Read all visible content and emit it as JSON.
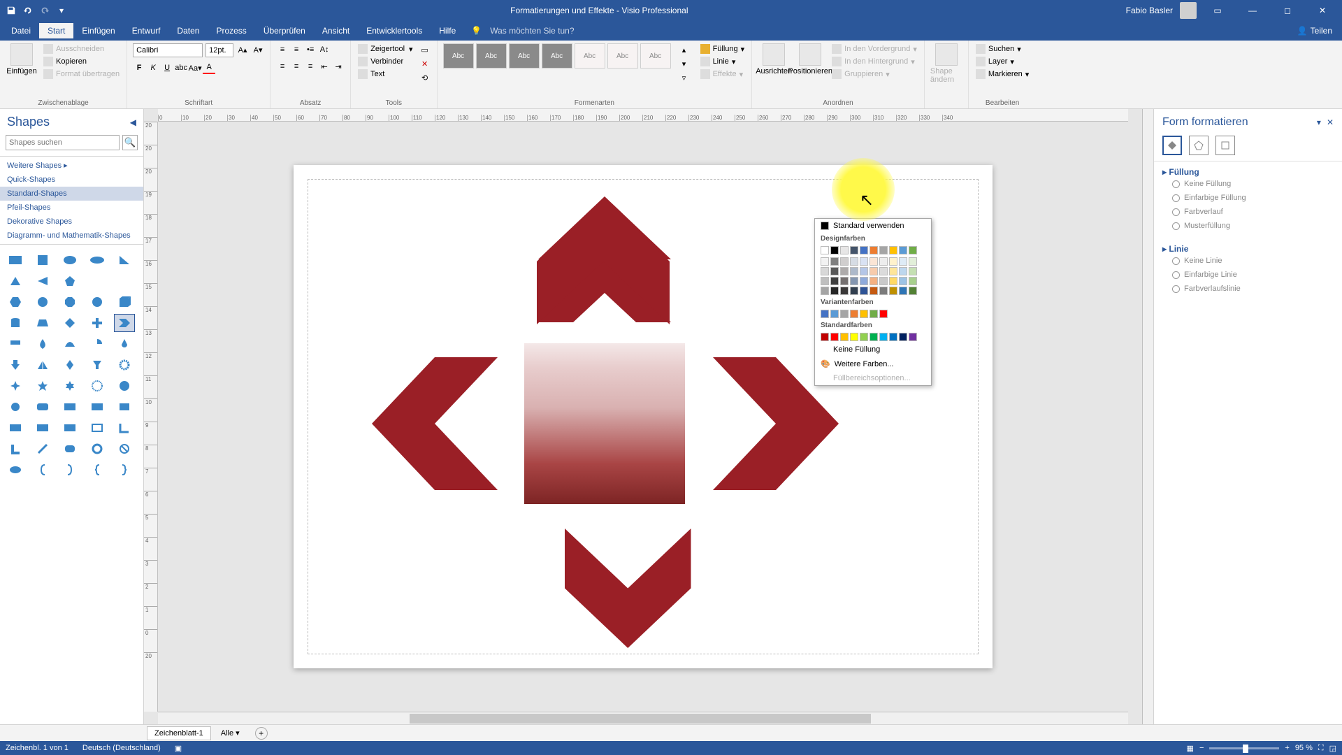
{
  "title": "Formatierungen und Effekte  -  Visio Professional",
  "user": "Fabio Basler",
  "share_label": "Teilen",
  "tabs": [
    "Datei",
    "Start",
    "Einfügen",
    "Entwurf",
    "Daten",
    "Prozess",
    "Überprüfen",
    "Ansicht",
    "Entwicklertools",
    "Hilfe"
  ],
  "active_tab": "Start",
  "tell_me": "Was möchten Sie tun?",
  "groups": {
    "clipboard": {
      "label": "Zwischenablage",
      "paste": "Einfügen",
      "cut": "Ausschneiden",
      "copy": "Kopieren",
      "painter": "Format übertragen"
    },
    "font": {
      "label": "Schriftart",
      "name": "Calibri",
      "size": "12pt."
    },
    "paragraph": {
      "label": "Absatz"
    },
    "tools": {
      "label": "Tools",
      "pointer": "Zeigertool",
      "connector": "Verbinder",
      "text": "Text"
    },
    "styles": {
      "label": "Formenarten",
      "fill": "Füllung",
      "line": "Linie",
      "effects": "Effekte"
    },
    "arrange": {
      "label": "Anordnen",
      "align": "Ausrichten",
      "position": "Positionieren",
      "front": "In den Vordergrund",
      "back": "In den Hintergrund",
      "group": "Gruppieren"
    },
    "shape_change": {
      "label": "Shape ändern"
    },
    "edit": {
      "label": "Bearbeiten",
      "find": "Suchen",
      "layer": "Layer",
      "select": "Markieren"
    }
  },
  "shapes_pane": {
    "title": "Shapes",
    "search_ph": "Shapes suchen",
    "categories": [
      "Weitere Shapes",
      "Quick-Shapes",
      "Standard-Shapes",
      "Pfeil-Shapes",
      "Dekorative Shapes",
      "Diagramm- und Mathematik-Shapes"
    ],
    "selected_cat": "Standard-Shapes"
  },
  "color_popup": {
    "auto": "Standard verwenden",
    "design": "Designfarben",
    "variant": "Variantenfarben",
    "standard": "Standardfarben",
    "nofill": "Keine Füllung",
    "more": "Weitere Farben...",
    "fillopts": "Füllbereichsoptionen..."
  },
  "format_pane": {
    "title": "Form formatieren",
    "fill": "Füllung",
    "fill_opts": [
      "Keine Füllung",
      "Einfarbige Füllung",
      "Farbverlauf",
      "Musterfüllung"
    ],
    "line": "Linie",
    "line_opts": [
      "Keine Linie",
      "Einfarbige Linie",
      "Farbverlaufslinie"
    ]
  },
  "sheet": {
    "tab": "Zeichenblatt-1",
    "all": "Alle"
  },
  "status": {
    "page": "Zeichenbl. 1 von 1",
    "lang": "Deutsch (Deutschland)",
    "zoom": "95 %"
  },
  "colors": {
    "design_row": [
      "#ffffff",
      "#000000",
      "#e7e6e6",
      "#44546a",
      "#4472c4",
      "#ed7d31",
      "#a5a5a5",
      "#ffc000",
      "#5b9bd5",
      "#70ad47"
    ],
    "design_shades": [
      [
        "#f2f2f2",
        "#7f7f7f",
        "#d0cece",
        "#d6dce4",
        "#d9e2f3",
        "#fbe5d5",
        "#ededed",
        "#fff2cc",
        "#deebf6",
        "#e2efd9"
      ],
      [
        "#d8d8d8",
        "#595959",
        "#aeabab",
        "#adb9ca",
        "#b4c6e7",
        "#f7cbac",
        "#dbdbdb",
        "#fee599",
        "#bdd7ee",
        "#c5e0b3"
      ],
      [
        "#bfbfbf",
        "#3f3f3f",
        "#757070",
        "#8496b0",
        "#8eaadb",
        "#f4b183",
        "#c9c9c9",
        "#ffd965",
        "#9cc3e5",
        "#a8d08d"
      ],
      [
        "#a5a5a5",
        "#262626",
        "#3a3838",
        "#323f4f",
        "#2f5496",
        "#c55a11",
        "#7b7b7b",
        "#bf9000",
        "#2e75b5",
        "#538135"
      ]
    ],
    "variant": [
      "#4472c4",
      "#5b9bd5",
      "#a5a5a5",
      "#ed7d31",
      "#ffc000",
      "#70ad47",
      "#ff0000"
    ],
    "standard": [
      "#c00000",
      "#ff0000",
      "#ffc000",
      "#ffff00",
      "#92d050",
      "#00b050",
      "#00b0f0",
      "#0070c0",
      "#002060",
      "#7030a0"
    ]
  },
  "ruler_h": [
    "0",
    "10",
    "20",
    "30",
    "40",
    "50",
    "60",
    "70",
    "80",
    "90",
    "100",
    "110",
    "120",
    "130",
    "140",
    "150",
    "160",
    "170",
    "180",
    "190",
    "200",
    "210",
    "220",
    "230",
    "240",
    "250",
    "260",
    "270",
    "280",
    "290",
    "300",
    "310",
    "320",
    "330",
    "340"
  ],
  "ruler_v": [
    "20",
    "20",
    "20",
    "19",
    "18",
    "17",
    "16",
    "15",
    "14",
    "13",
    "12",
    "11",
    "10",
    "9",
    "8",
    "7",
    "6",
    "5",
    "4",
    "3",
    "2",
    "1",
    "0",
    "20"
  ]
}
